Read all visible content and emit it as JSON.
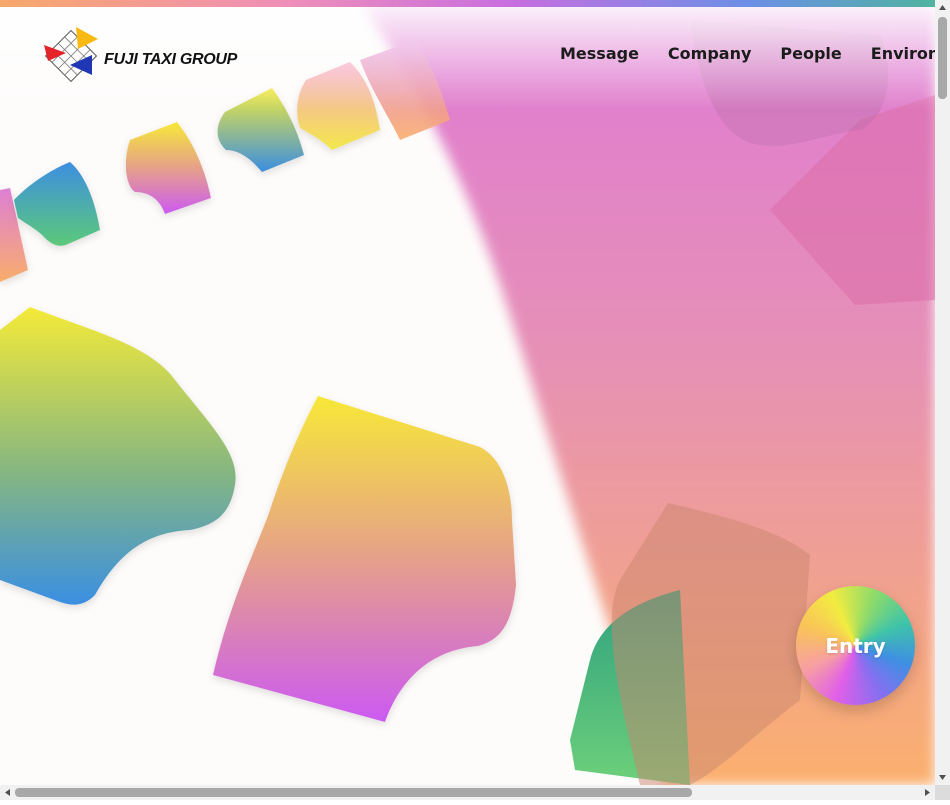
{
  "brand": {
    "name": "FUJI TAXI GROUP",
    "logo_colors": {
      "red": "#e5232a",
      "yellow": "#f7b912",
      "blue": "#1f37b5"
    }
  },
  "nav": {
    "items": [
      {
        "label": "Message"
      },
      {
        "label": "Company"
      },
      {
        "label": "People"
      },
      {
        "label": "Environment"
      }
    ]
  },
  "entry": {
    "label": "Entry"
  },
  "theme": {
    "accent_gradient": [
      "#f7a86a",
      "#f08fb8",
      "#c76ee0",
      "#6b8fe6",
      "#4fb3a0"
    ],
    "hero_colors": [
      "#f3ea3c",
      "#3d8fe0",
      "#cf5bf0",
      "#5cc97a",
      "#e67bd6",
      "#fbb06a"
    ]
  },
  "icons": {
    "logo": "fuji-taxi-grid-logo-icon",
    "scroll_up": "triangle-up-icon",
    "scroll_down": "triangle-down-icon",
    "scroll_left": "triangle-left-icon",
    "scroll_right": "triangle-right-icon"
  }
}
